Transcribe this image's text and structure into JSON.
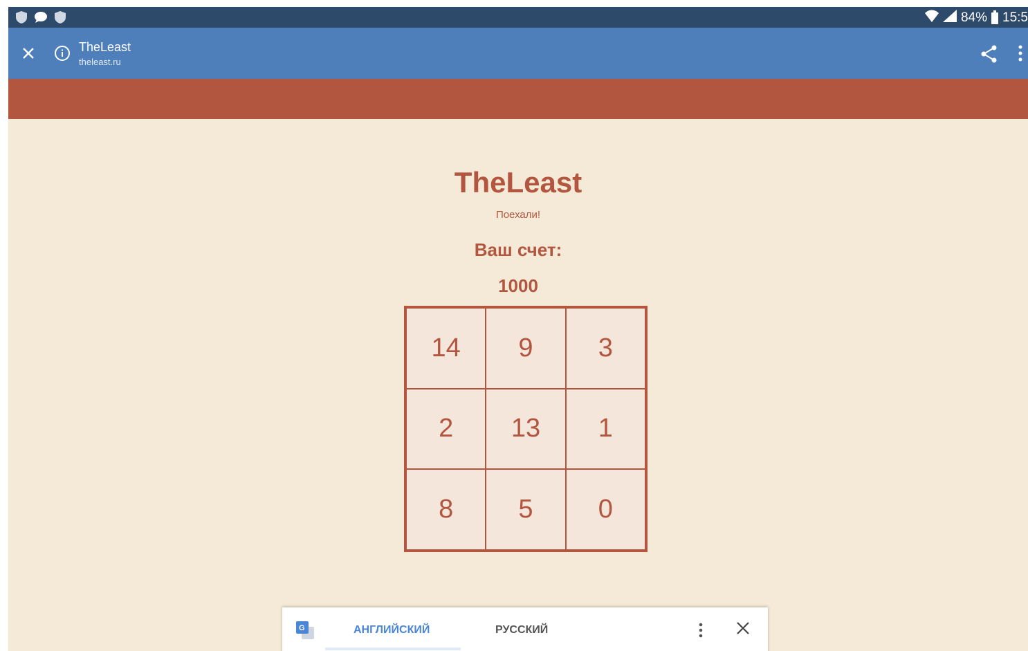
{
  "status_bar": {
    "battery": "84%",
    "time": "15:5"
  },
  "toolbar": {
    "title": "TheLeast",
    "url": "theleast.ru"
  },
  "game": {
    "title": "TheLeast",
    "subtitle": "Поехали!",
    "score_label": "Ваш счет:",
    "score_value": "1000",
    "cells": [
      "14",
      "9",
      "3",
      "2",
      "13",
      "1",
      "8",
      "5",
      "0"
    ]
  },
  "translate_bar": {
    "source_language": "АНГЛИЙСКИЙ",
    "target_language": "РУССКИЙ"
  },
  "colors": {
    "accent": "#b25640",
    "toolbar": "#4f7fba",
    "background": "#f5ead7"
  }
}
